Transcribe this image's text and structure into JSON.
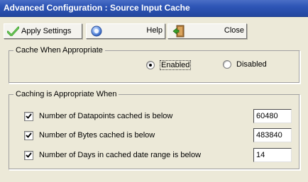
{
  "window": {
    "title": "Advanced Configuration : Source Input Cache"
  },
  "toolbar": {
    "apply_label": "Apply Settings",
    "help_label": "Help",
    "close_label": "Close"
  },
  "cache_group": {
    "label": "Cache When Appropriate",
    "options": [
      {
        "label": "Enabled",
        "selected": true
      },
      {
        "label": "Disabled",
        "selected": false
      }
    ]
  },
  "conditions_group": {
    "label": "Caching is Appropriate When",
    "rows": [
      {
        "label": "Number of Datapoints cached is below",
        "checked": true,
        "value": "60480"
      },
      {
        "label": "Number of Bytes cached is below",
        "checked": true,
        "value": "483840"
      },
      {
        "label": "Number of Days in cached date range is below",
        "checked": true,
        "value": "14"
      }
    ]
  },
  "colors": {
    "titlebar": "#2e55b6",
    "face": "#ece9d8",
    "apply_icon": "#3aa02a"
  },
  "icons": {
    "apply": "checkmark-icon",
    "help": "help-icon",
    "close": "exit-door-icon"
  }
}
